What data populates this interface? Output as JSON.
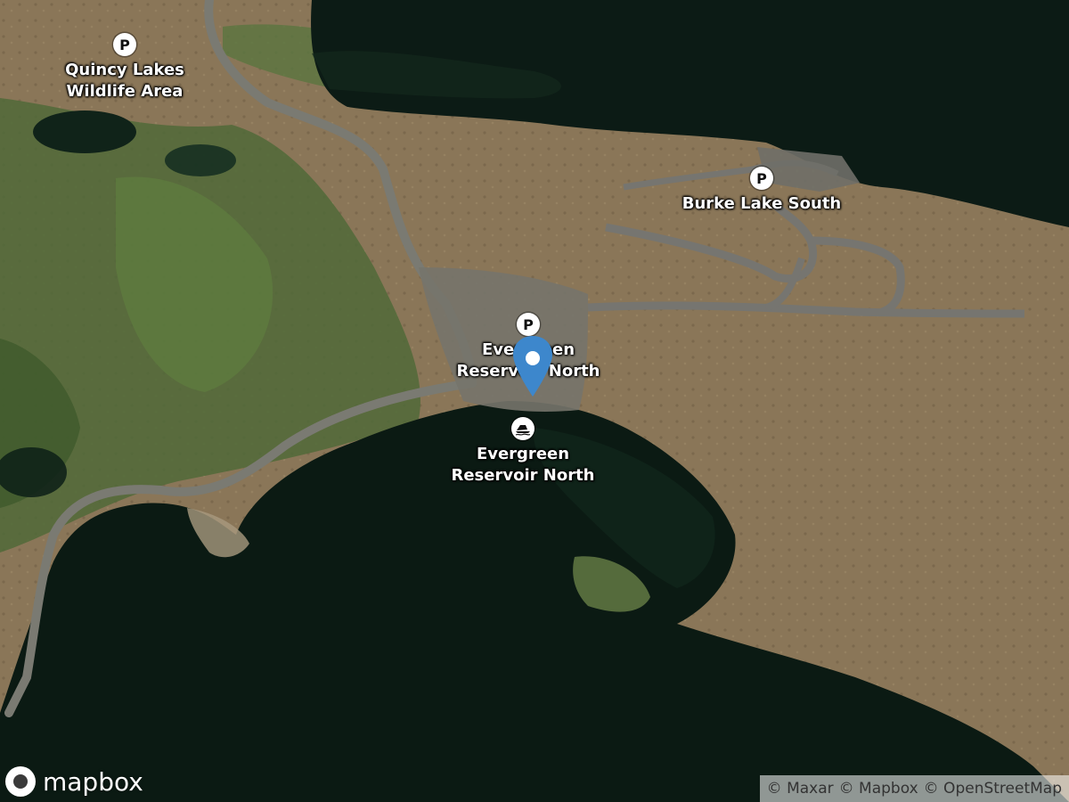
{
  "map": {
    "imagery": "satellite",
    "logo_text": "mapbox",
    "attribution": [
      "© Maxar",
      "© Mapbox",
      "© OpenStreetMap"
    ],
    "colors": {
      "water": "#0d1f17",
      "dry_land": "#8e7a5a",
      "vegetation": "#4f6a35",
      "road": "#77776f",
      "pin": "#3d87cc"
    }
  },
  "pois": [
    {
      "id": "quincy",
      "icon": "parking-icon",
      "icon_text": "P",
      "label": "Quincy Lakes\nWildlife Area"
    },
    {
      "id": "burke",
      "icon": "parking-icon",
      "icon_text": "P",
      "label": "Burke Lake South"
    },
    {
      "id": "evergreen-parking",
      "icon": "parking-icon",
      "icon_text": "P",
      "label": "Evergreen\nReservoir North"
    },
    {
      "id": "evergreen-boat",
      "icon": "boat-launch-icon",
      "icon_text": "",
      "label": "Evergreen\nReservoir North"
    }
  ]
}
